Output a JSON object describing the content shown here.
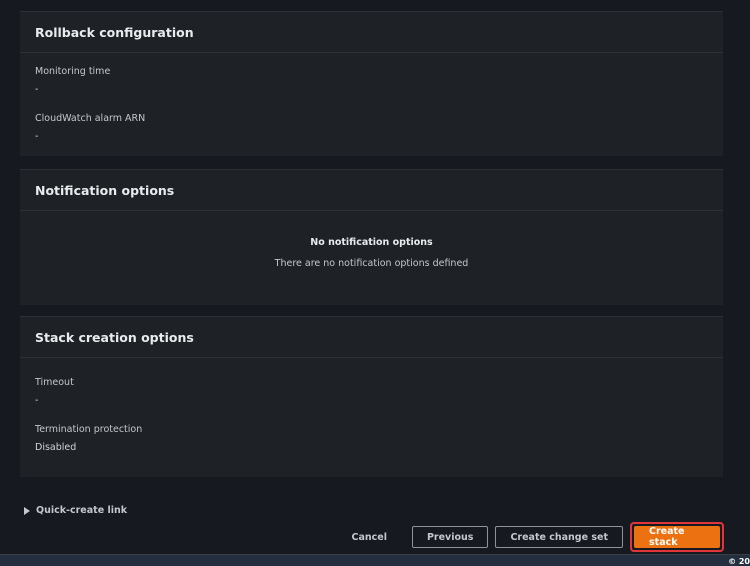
{
  "rollback": {
    "title": "Rollback configuration",
    "monitoring_label": "Monitoring time",
    "monitoring_value": "-",
    "alarm_label": "CloudWatch alarm ARN",
    "alarm_value": "-"
  },
  "notifications": {
    "title": "Notification options",
    "empty_title": "No notification options",
    "empty_desc": "There are no notification options defined"
  },
  "stack_options": {
    "title": "Stack creation options",
    "timeout_label": "Timeout",
    "timeout_value": "-",
    "termination_label": "Termination protection",
    "termination_value": "Disabled"
  },
  "quick_create": {
    "label": "Quick-create link"
  },
  "actions": {
    "cancel": "Cancel",
    "previous": "Previous",
    "change_set": "Create change set",
    "create": "Create stack"
  },
  "footer": {
    "copyright": "© 20"
  },
  "colors": {
    "primary": "#ec7211",
    "highlight": "#e0363b",
    "background": "#16191f"
  }
}
